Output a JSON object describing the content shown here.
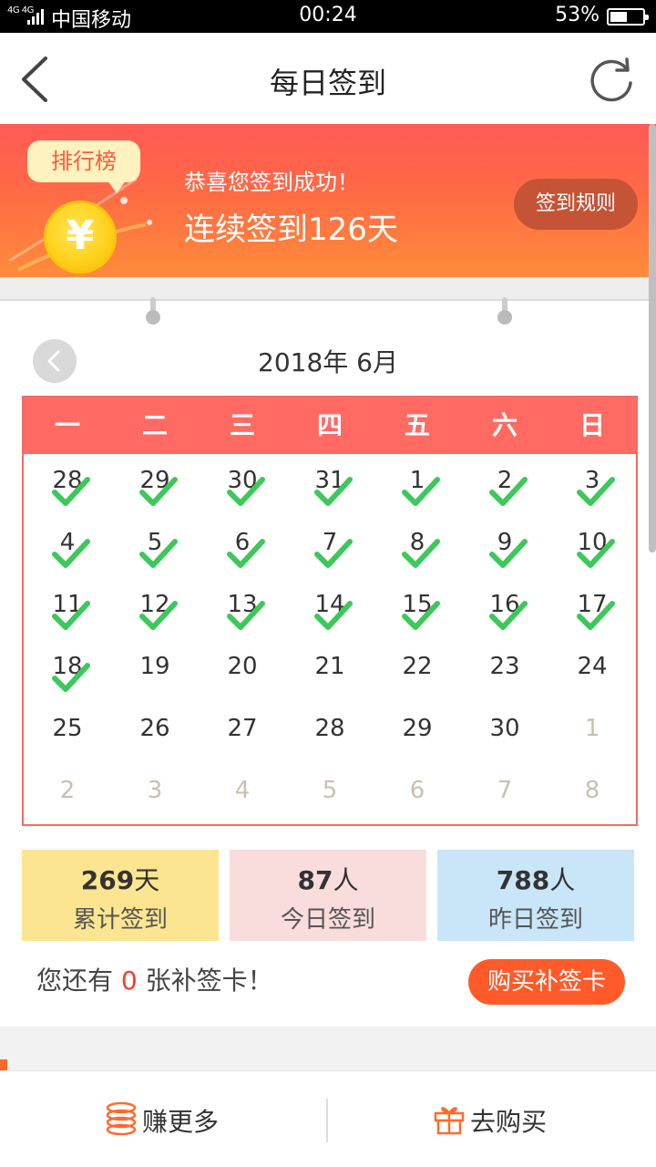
{
  "status_bar": {
    "network": "4G 4G",
    "carrier": "中国移动",
    "time": "00:24",
    "battery": "53%",
    "battery_level": 0.53
  },
  "header": {
    "title": "每日签到",
    "back_icon": "chevron-left-icon",
    "refresh_icon": "refresh-icon"
  },
  "banner": {
    "rank_label": "排行榜",
    "coin_symbol": "¥",
    "congrats": "恭喜您签到成功！",
    "streak": "连续签到126天",
    "rules_button": "签到规则"
  },
  "calendar": {
    "month_title": "2018年 6月",
    "weekdays": [
      "一",
      "二",
      "三",
      "四",
      "五",
      "六",
      "日"
    ],
    "days": [
      {
        "d": "28",
        "other": false,
        "checked": true
      },
      {
        "d": "29",
        "other": false,
        "checked": true
      },
      {
        "d": "30",
        "other": false,
        "checked": true
      },
      {
        "d": "31",
        "other": false,
        "checked": true
      },
      {
        "d": "1",
        "other": false,
        "checked": true
      },
      {
        "d": "2",
        "other": false,
        "checked": true
      },
      {
        "d": "3",
        "other": false,
        "checked": true
      },
      {
        "d": "4",
        "other": false,
        "checked": true
      },
      {
        "d": "5",
        "other": false,
        "checked": true
      },
      {
        "d": "6",
        "other": false,
        "checked": true
      },
      {
        "d": "7",
        "other": false,
        "checked": true
      },
      {
        "d": "8",
        "other": false,
        "checked": true
      },
      {
        "d": "9",
        "other": false,
        "checked": true
      },
      {
        "d": "10",
        "other": false,
        "checked": true
      },
      {
        "d": "11",
        "other": false,
        "checked": true
      },
      {
        "d": "12",
        "other": false,
        "checked": true
      },
      {
        "d": "13",
        "other": false,
        "checked": true
      },
      {
        "d": "14",
        "other": false,
        "checked": true
      },
      {
        "d": "15",
        "other": false,
        "checked": true
      },
      {
        "d": "16",
        "other": false,
        "checked": true
      },
      {
        "d": "17",
        "other": false,
        "checked": true
      },
      {
        "d": "18",
        "other": false,
        "checked": true
      },
      {
        "d": "19",
        "other": false,
        "checked": false
      },
      {
        "d": "20",
        "other": false,
        "checked": false
      },
      {
        "d": "21",
        "other": false,
        "checked": false
      },
      {
        "d": "22",
        "other": false,
        "checked": false
      },
      {
        "d": "23",
        "other": false,
        "checked": false
      },
      {
        "d": "24",
        "other": false,
        "checked": false
      },
      {
        "d": "25",
        "other": false,
        "checked": false
      },
      {
        "d": "26",
        "other": false,
        "checked": false
      },
      {
        "d": "27",
        "other": false,
        "checked": false
      },
      {
        "d": "28",
        "other": false,
        "checked": false
      },
      {
        "d": "29",
        "other": false,
        "checked": false
      },
      {
        "d": "30",
        "other": false,
        "checked": false
      },
      {
        "d": "1",
        "other": true,
        "checked": false
      },
      {
        "d": "2",
        "other": true,
        "checked": false
      },
      {
        "d": "3",
        "other": true,
        "checked": false
      },
      {
        "d": "4",
        "other": true,
        "checked": false
      },
      {
        "d": "5",
        "other": true,
        "checked": false
      },
      {
        "d": "6",
        "other": true,
        "checked": false
      },
      {
        "d": "7",
        "other": true,
        "checked": false
      },
      {
        "d": "8",
        "other": true,
        "checked": false
      }
    ]
  },
  "stats": [
    {
      "value": "269",
      "unit": "天",
      "label": "累计签到"
    },
    {
      "value": "87",
      "unit": "人",
      "label": "今日签到"
    },
    {
      "value": "788",
      "unit": "人",
      "label": "昨日签到"
    }
  ],
  "makeup": {
    "prefix": "您还有 ",
    "count": "0",
    "suffix": " 张补签卡！",
    "buy_button": "购买补签卡"
  },
  "bottom_bar": {
    "earn_label": "赚更多",
    "earn_icon": "coins-icon",
    "shop_label": "去购买",
    "shop_icon": "gift-icon"
  },
  "colors": {
    "accent": "#ff6a63",
    "check": "#3cc85a",
    "button": "#ff5a2a"
  }
}
